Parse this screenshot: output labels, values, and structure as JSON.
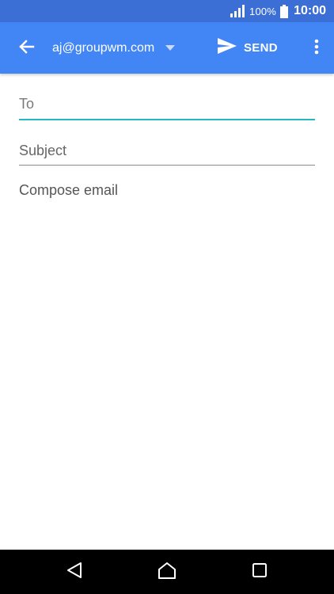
{
  "status_bar": {
    "battery_percent": "100%",
    "time": "10:00",
    "signal_icon": "signal-icon",
    "battery_icon": "battery-icon"
  },
  "app_bar": {
    "back_icon": "arrow-back-icon",
    "account_email": "aj@groupwm.com",
    "account_dropdown_icon": "chevron-down-icon",
    "send_icon": "send-icon",
    "send_label": "SEND",
    "overflow_icon": "more-vert-icon"
  },
  "compose": {
    "to_placeholder": "To",
    "to_value": "",
    "subject_placeholder": "Subject",
    "subject_value": "",
    "body_placeholder": "Compose email",
    "body_value": ""
  },
  "nav_bar": {
    "back_icon": "nav-back-icon",
    "home_icon": "nav-home-icon",
    "recents_icon": "nav-recents-icon"
  },
  "colors": {
    "status_bar": "#3b6fd6",
    "app_bar": "#4285f4",
    "focus_underline": "#22b9c2",
    "nav_bar": "#000000"
  }
}
